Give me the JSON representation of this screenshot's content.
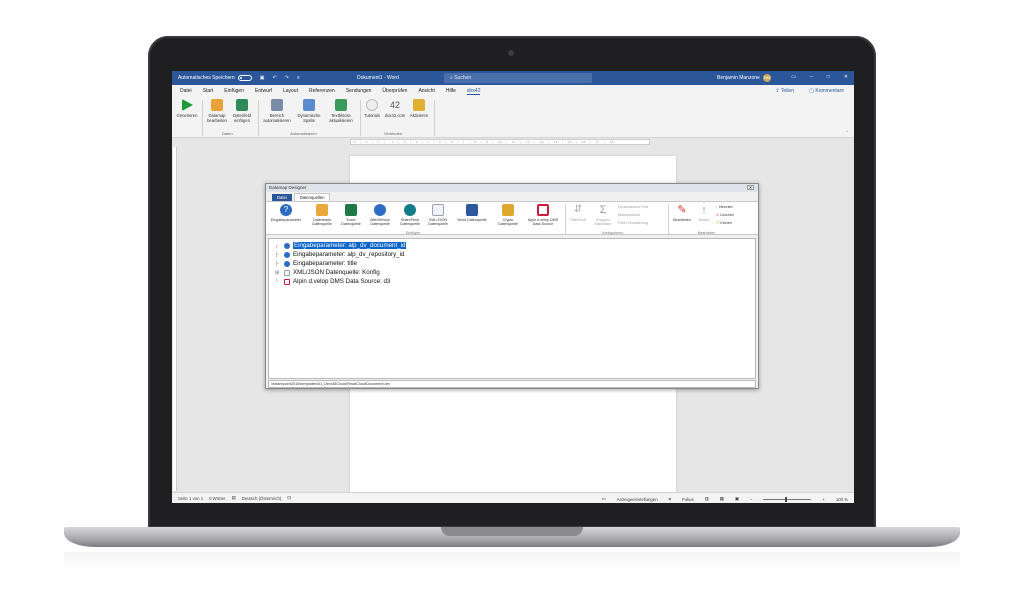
{
  "titlebar": {
    "autosave_label": "Automatisches Speichern",
    "document_title": "Dokument1 - Word",
    "search_placeholder": "Suchen",
    "user_name": "Benjamin Manzone",
    "avatar_initials": "BM"
  },
  "menu": {
    "items": [
      "Datei",
      "Start",
      "Einfügen",
      "Entwurf",
      "Layout",
      "Referenzen",
      "Sendungen",
      "Überprüfen",
      "Ansicht",
      "Hilfe",
      "dox42"
    ],
    "active_index": 10,
    "share_label": "Teilen",
    "comments_label": "Kommentare"
  },
  "ribbon": {
    "buttons": [
      {
        "label": "Generieren",
        "icon": "play-icon",
        "color": "#1e9a3a"
      },
      {
        "label": "Datamap bearbeiten",
        "icon": "datamap-icon",
        "color": "#e8a23a"
      },
      {
        "label": "Datenfeld einfügen",
        "icon": "datafield-icon",
        "color": "#2e8b57"
      },
      {
        "label": "Bereich automatisieren",
        "icon": "area-icon",
        "color": "#7a8aa8"
      },
      {
        "label": "Dynamische Spalte",
        "icon": "column-icon",
        "color": "#5a8ad0"
      },
      {
        "label": "Textblöcke aktualisieren",
        "icon": "textblock-icon",
        "color": "#3a9a5a"
      },
      {
        "label": "Tutorials",
        "icon": "lightbulb-icon",
        "color": "#d8d8d8"
      },
      {
        "label": "dox42.com",
        "icon": "dox42-icon",
        "color": "#555555"
      },
      {
        "label": "Aktivieren",
        "icon": "key-icon",
        "color": "#e0b030"
      }
    ],
    "groups": [
      "Daten",
      "Automatisieren",
      "Verbinden"
    ]
  },
  "ruler_text": "· 3 · | · 2 · | · 1 · | · · 1 · | · 2 · | · 3 · | · 4 · | · 5 · | · 6 · | · 7 · | · 8 · | · 9 · | · 10 · | · 11 · | · 12 · | · 13 · | · 14 · | · 15 · | · 16 · | · 17 · | · 18",
  "statusbar": {
    "page": "Seite 1 von 1",
    "words": "0 Wörter",
    "language": "Deutsch (Österreich)",
    "display_settings": "Anzeigeeinstellungen",
    "focus": "Fokus",
    "zoom": "100 %"
  },
  "dialog": {
    "title": "Datamap Designer",
    "tabs": [
      "Datei",
      "Datenquellen"
    ],
    "buttons": [
      {
        "label": "Eingabeparameter",
        "icon": "question-icon",
        "color": "#2b6cc4"
      },
      {
        "label": "Datenbank Datenquelle",
        "icon": "database-icon",
        "color": "#e8a83a"
      },
      {
        "label": "Excel Datenquelle",
        "icon": "excel-icon",
        "color": "#1e7a45"
      },
      {
        "label": "WebService Datenquelle",
        "icon": "globe-icon",
        "color": "#2b6cc4"
      },
      {
        "label": "SharePoint Datenquelle",
        "icon": "sharepoint-icon",
        "color": "#127c8a"
      },
      {
        "label": "XML/JSON Datenquelle",
        "icon": "xml-icon",
        "color": "#c8c8d4"
      },
      {
        "label": "Word Datenquelle",
        "icon": "word-icon",
        "color": "#2b579a"
      },
      {
        "label": "Crypto Datenquelle",
        "icon": "crypto-key-icon",
        "color": "#e0a830"
      },
      {
        "label": "Alpin d.velop DMS Data Source",
        "icon": "dms-icon",
        "color": "#c81e3c"
      },
      {
        "label": "Filter/Sort",
        "icon": "filter-sort-icon",
        "color": "#b8b8b8"
      },
      {
        "label": "Gruppen Kalkulator",
        "icon": "sigma-icon",
        "color": "#b8b8b8"
      },
      {
        "label": "Bearbeiten",
        "icon": "pencil-icon",
        "color": "#d23a2a"
      },
      {
        "label": "Hinauf",
        "icon": "arrow-up-icon",
        "color": "#a0a0a0"
      }
    ],
    "config_items": [
      "Dynamisches Feld",
      "Massendruck",
      "Feld Formatierung"
    ],
    "edit_items": [
      "Hinunter",
      "Löschen",
      "Klonen"
    ],
    "groups": [
      "Einfügen",
      "Konfigurieren",
      "Bearbeiten"
    ],
    "tree": [
      {
        "label": "Eingabeparameter: alp_dv_document_id",
        "icon": "question-icon",
        "color": "#2b6cc4",
        "selected": true
      },
      {
        "label": "Eingabeparameter: alp_dv_repository_id",
        "icon": "question-icon",
        "color": "#2b6cc4",
        "selected": false
      },
      {
        "label": "Eingabeparameter: title",
        "icon": "question-icon",
        "color": "#2b6cc4",
        "selected": false
      },
      {
        "label": "XML/JSON Datenquelle: Konfig",
        "icon": "xml-icon",
        "color": "#9aa0b4",
        "selected": false
      },
      {
        "label": "Alpin d.velop DMS Data Source: d3",
        "icon": "dms-icon",
        "color": "#c81e3c",
        "selected": false
      }
    ],
    "path": "\\\\sharepoint2010\\templates\\01_Dev\\d3Cloud\\ReadCloudDocument.dm"
  }
}
